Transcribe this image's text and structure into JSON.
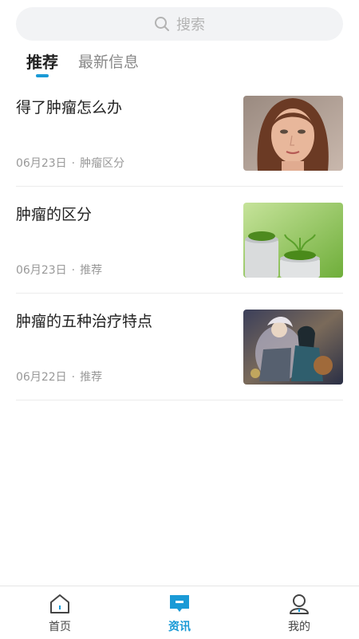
{
  "search": {
    "placeholder": "搜索",
    "icon": "search-icon"
  },
  "tabs": [
    {
      "label": "推荐",
      "active": true
    },
    {
      "label": "最新信息",
      "active": false
    }
  ],
  "articles": [
    {
      "title": "得了肿瘤怎么办",
      "date": "06月23日",
      "separator": "·",
      "category": "肿瘤区分",
      "thumbnail": "portrait-photo"
    },
    {
      "title": "肿瘤的区分",
      "date": "06月23日",
      "separator": "·",
      "category": "推荐",
      "thumbnail": "plant-photo"
    },
    {
      "title": "肿瘤的五种治疗特点",
      "date": "06月22日",
      "separator": "·",
      "category": "推荐",
      "thumbnail": "fantasy-art"
    }
  ],
  "tabbar": [
    {
      "label": "首页",
      "icon": "home-icon",
      "active": false
    },
    {
      "label": "资讯",
      "icon": "news-icon",
      "active": true
    },
    {
      "label": "我的",
      "icon": "profile-icon",
      "active": false
    }
  ],
  "colors": {
    "accent": "#1a9ad6",
    "search_bg": "#f2f3f5",
    "meta_text": "#999999"
  }
}
